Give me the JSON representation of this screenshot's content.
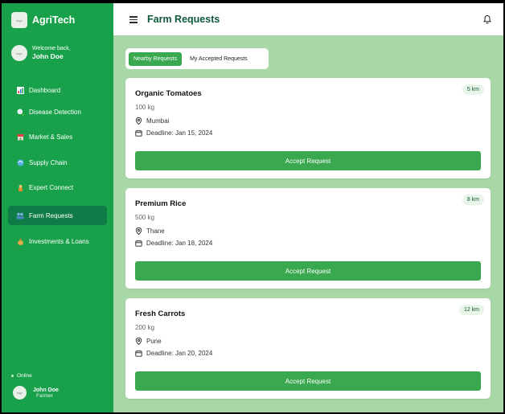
{
  "app": {
    "name": "AgriTech",
    "logo_text": "logo"
  },
  "sidebar": {
    "welcome": "Welcome back,",
    "user_name": "John Doe",
    "items": [
      {
        "label": "Dashboard",
        "icon": "chart-icon"
      },
      {
        "label": "Disease Detection",
        "icon": "magnifier-icon"
      },
      {
        "label": "Market & Sales",
        "icon": "store-icon"
      },
      {
        "label": "Supply Chain",
        "icon": "recycle-icon"
      },
      {
        "label": "Expert Connect",
        "icon": "farmer-icon"
      },
      {
        "label": "Farm Requests",
        "icon": "users-icon",
        "active": true
      },
      {
        "label": "Investments & Loans",
        "icon": "money-bag-icon"
      }
    ],
    "status": "Online",
    "footer_user": {
      "name": "John Doe",
      "role": "Farmer"
    }
  },
  "header": {
    "title": "Farm Requests"
  },
  "tabs": [
    {
      "label": "Nearby Requests",
      "active": true
    },
    {
      "label": "My Accepted Requests",
      "active": false
    }
  ],
  "requests": [
    {
      "name": "Organic Tomatoes",
      "quantity": "100 kg",
      "location": "Mumbai",
      "deadline": "Deadline: Jan 15, 2024",
      "distance": "5 km",
      "action": "Accept Request"
    },
    {
      "name": "Premium Rice",
      "quantity": "500 kg",
      "location": "Thane",
      "deadline": "Deadline: Jan 18, 2024",
      "distance": "8 km",
      "action": "Accept Request"
    },
    {
      "name": "Fresh Carrots",
      "quantity": "200 kg",
      "location": "Pune",
      "deadline": "Deadline: Jan 20, 2024",
      "distance": "12 km",
      "action": "Accept Request"
    }
  ],
  "colors": {
    "sidebar": "#18a14a",
    "active_nav": "#0f7c47",
    "accent": "#3aa84f",
    "background": "#a8d8a8",
    "title": "#0f5a38"
  }
}
